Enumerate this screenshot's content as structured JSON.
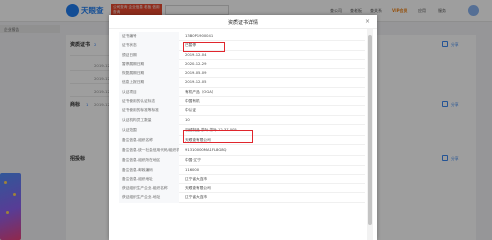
{
  "app": {
    "logo_text": "天眼查",
    "promo_text": "公司查询 企业信息 老板 信用查询"
  },
  "nav": {
    "items": [
      "查公司",
      "查老板",
      "查关系",
      "VIP会员",
      "应用",
      "服务"
    ]
  },
  "left_tab": "企业报告",
  "background": {
    "section1_title": "资质证书",
    "section1_count": "2",
    "section2_title": "商标",
    "section2_count": "1",
    "section3_title": "招投标",
    "bg_rows": [
      "2019-12-05",
      "2019-12-03",
      "2019-12-04",
      "2019-12-02"
    ],
    "share_label": "分享"
  },
  "modal": {
    "title": "资质证书详情",
    "close_label": "×",
    "rows": [
      {
        "label": "证书编号",
        "value": "13B0P1900041"
      },
      {
        "label": "证书状态",
        "value": "已暂停"
      },
      {
        "label": "颁证日期",
        "value": "2019-12-04"
      },
      {
        "label": "暂停展期日期",
        "value": "2020-12-29"
      },
      {
        "label": "恢复展期日期",
        "value": "2019-05-09"
      },
      {
        "label": "信息上报日期",
        "value": "2019-12-05"
      },
      {
        "label": "认证项目",
        "value": "有机产品（OGA）"
      },
      {
        "label": "证书使用的认证标志",
        "value": "中国有机"
      },
      {
        "label": "证书使用的标准等标准",
        "value": "中认证"
      },
      {
        "label": "认证机构员工数量",
        "value": "10"
      },
      {
        "label": "认证范围",
        "value": "羽绒制品 茶叶 茶叶 12.37.005"
      },
      {
        "label": "备注信息-组织名称",
        "value": "天眼查有限公司"
      },
      {
        "label": "备注信息-统一社会信用代码/组织机构代码",
        "value": "91310000MA1FL8G8Q"
      },
      {
        "label": "备注信息-组织所在地区",
        "value": "中国·辽宁"
      },
      {
        "label": "备注信息-邮政编码",
        "value": "116000"
      },
      {
        "label": "备注信息-组织地址",
        "value": "辽宁省大连市"
      },
      {
        "label": "获证组织生产企业-组织名称",
        "value": "天眼查有限公司"
      },
      {
        "label": "获证组织生产企业-地址",
        "value": "辽宁省大连市"
      }
    ]
  }
}
